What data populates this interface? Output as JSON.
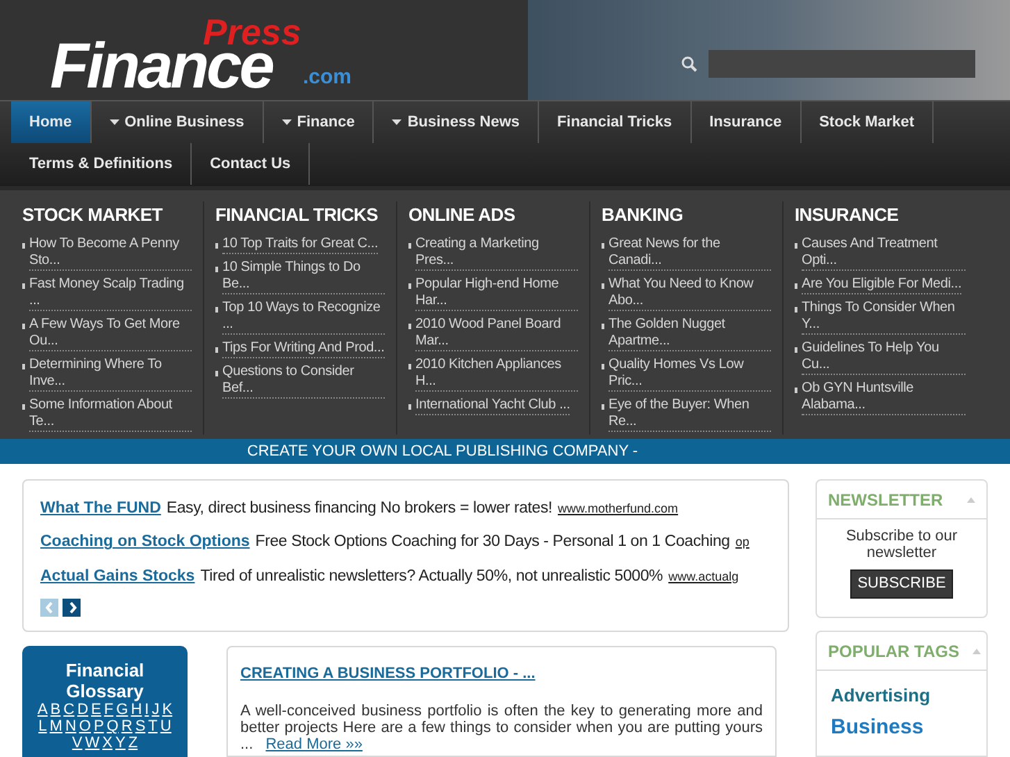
{
  "header": {
    "logo": {
      "main": "Finance",
      "press": "Press",
      "suffix": ".com"
    }
  },
  "nav": {
    "rows": [
      [
        {
          "label": "Home",
          "dropdown": false,
          "selected": true
        },
        {
          "label": "Online Business",
          "dropdown": true,
          "selected": false
        },
        {
          "label": "Finance",
          "dropdown": true,
          "selected": false
        },
        {
          "label": "Business News",
          "dropdown": true,
          "selected": false
        },
        {
          "label": "Financial Tricks",
          "dropdown": false,
          "selected": false
        },
        {
          "label": "Insurance",
          "dropdown": false,
          "selected": false
        },
        {
          "label": "Stock Market",
          "dropdown": false,
          "selected": false
        }
      ],
      [
        {
          "label": "Terms & Definitions",
          "dropdown": false,
          "selected": false
        },
        {
          "label": "Contact Us",
          "dropdown": false,
          "selected": false
        }
      ]
    ]
  },
  "mega_menu": [
    {
      "title": "STOCK MARKET",
      "items": [
        "How To Become A Penny Sto...",
        "Fast Money Scalp Trading ...",
        "A Few Ways To Get More Ou...",
        "Determining Where To Inve...",
        "Some Information About Te..."
      ]
    },
    {
      "title": "FINANCIAL TRICKS",
      "items": [
        "10 Top Traits for Great C...",
        "10 Simple Things to Do Be...",
        "Top 10 Ways to Recognize ...",
        "Tips For Writing And Prod...",
        "Questions to Consider Bef..."
      ]
    },
    {
      "title": "ONLINE ADS",
      "items": [
        "Creating a Marketing Pres...",
        "Popular High-end Home Har...",
        "2010 Wood Panel Board Mar...",
        "2010 Kitchen Appliances H...",
        "International Yacht Club ..."
      ]
    },
    {
      "title": "BANKING",
      "items": [
        "Great News for the Canadi...",
        "What You Need to Know Abo...",
        "The Golden Nugget Apartme...",
        "Quality Homes Vs Low Pric...",
        "Eye of the Buyer: When Re..."
      ]
    },
    {
      "title": "INSURANCE",
      "items": [
        "Causes And Treatment Opti...",
        "Are You Eligible For Medi...",
        "Things To Consider When Y...",
        "Guidelines To Help You Cu...",
        "Ob GYN Huntsville Alabama..."
      ]
    }
  ],
  "banner": "CREATE YOUR OWN LOCAL PUBLISHING COMPANY -",
  "ads": {
    "items": [
      {
        "title": "What The FUND",
        "text": "Easy, direct business financing No brokers = lower rates!",
        "url": "www.motherfund.com"
      },
      {
        "title": "Coaching on Stock Options",
        "text": "Free Stock Options Coaching for 30 Days - Personal 1 on 1 Coaching",
        "url": "op"
      },
      {
        "title": "Actual Gains Stocks",
        "text": "Tired of unrealistic newsletters? Actually 50%, not unrealistic 5000%",
        "url": "www.actualg"
      }
    ],
    "pager": [
      {
        "kind": "prev",
        "disabled": true
      },
      {
        "kind": "next",
        "disabled": false
      }
    ]
  },
  "glossary": {
    "title": "Financial Glossary",
    "letters": [
      "A",
      "B",
      "C",
      "D",
      "E",
      "F",
      "G",
      "H",
      "I",
      "J",
      "K",
      "L",
      "M",
      "N",
      "O",
      "P",
      "Q",
      "R",
      "S",
      "T",
      "U",
      "V",
      "W",
      "X",
      "Y",
      "Z"
    ]
  },
  "article": {
    "title": "CREATING A BUSINESS PORTFOLIO - ...",
    "text": "A well-conceived business portfolio is often the key to generating more and better projects Here are a few things to consider when you are putting yours ...",
    "read_more": "Read More »»"
  },
  "newsletter": {
    "title": "NEWSLETTER",
    "text": "Subscribe to our newsletter",
    "button": "SUBSCRIBE"
  },
  "popular_tags": {
    "title": "POPULAR TAGS",
    "tags": [
      {
        "label": "Advertising",
        "kind": "small",
        "color": "#1d6f86"
      },
      {
        "label": "Business",
        "kind": "large",
        "color": "#1f7ac0"
      }
    ]
  }
}
